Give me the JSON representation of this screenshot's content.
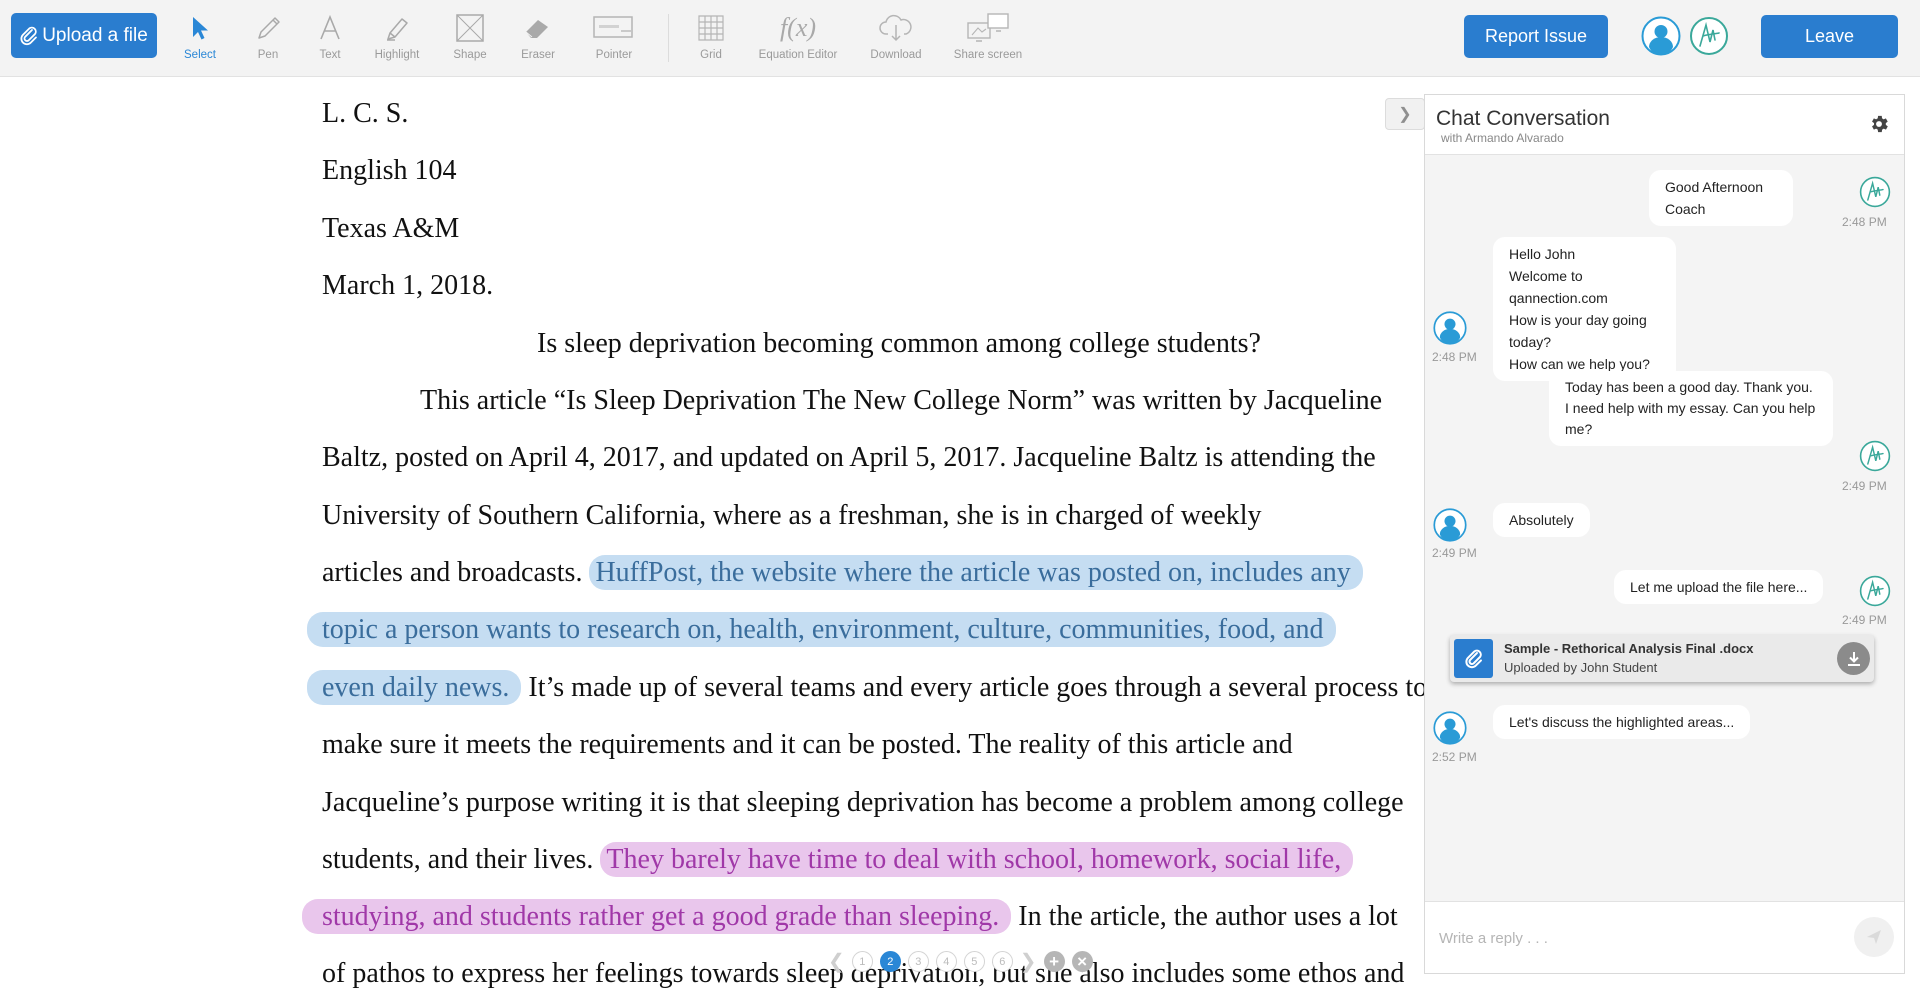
{
  "toolbar": {
    "upload_label": "Upload a file",
    "tools": [
      {
        "label": "Select",
        "icon": "cursor-icon",
        "active": true
      },
      {
        "label": "Pen",
        "icon": "pen-icon"
      },
      {
        "label": "Text",
        "icon": "text-icon"
      },
      {
        "label": "Highlight",
        "icon": "highlighter-icon"
      },
      {
        "label": "Shape",
        "icon": "shape-icon"
      },
      {
        "label": "Eraser",
        "icon": "eraser-icon"
      },
      {
        "label": "Pointer",
        "icon": "pointer-icon"
      },
      {
        "label": "Grid",
        "icon": "grid-icon"
      },
      {
        "label": "Equation Editor",
        "icon": "function-icon"
      },
      {
        "label": "Download",
        "icon": "cloud-download-icon"
      },
      {
        "label": "Share screen",
        "icon": "screens-icon"
      }
    ],
    "report_label": "Report Issue",
    "leave_label": "Leave"
  },
  "document": {
    "header_lines": [
      "L. C. S.",
      "English 104",
      "Texas A&M",
      "March 1, 2018."
    ],
    "title": "Is sleep deprivation becoming common among college students?",
    "para1": "This article “Is Sleep Deprivation The New College Norm” was written by Jacqueline",
    "line2": "Baltz, posted on April 4, 2017, and updated on April 5, 2017. Jacqueline Baltz is attending the",
    "line3": "University of Southern California, where as a freshman, she is in charged of weekly",
    "line4_plain": "articles and broadcasts.",
    "line4_hl": "HuffPost, the website where the article was posted on, includes any",
    "line5_hl": "topic a person wants to research on, health, environment, culture, communities, food, and",
    "line6_hl": "even daily news.",
    "line6_plain": "It’s made up of several teams and every article goes through a several process to",
    "line7": "make sure it meets the requirements and it can be posted. The reality of this article and",
    "line8": "Jacqueline’s purpose writing it is that sleeping deprivation has become a problem among college",
    "line9_plain": "students, and their lives.",
    "line9_hl": "They barely have time to deal with school, homework, social life,",
    "line10_hl": "studying, and students rather get a good grade than sleeping.",
    "line10_plain": "In the article, the author uses a lot",
    "line11": "of pathos to express her feelings towards sleep deprivation, but she also includes some ethos and"
  },
  "pagination": {
    "pages": [
      "1",
      "2",
      "3",
      "4",
      "5",
      "6"
    ],
    "current": "2"
  },
  "chat": {
    "title": "Chat Conversation",
    "subtitle": "with Armando Alvarado",
    "messages": [
      {
        "from": "coach",
        "lines": [
          "Good Afternoon Coach"
        ],
        "time": "2:48 PM"
      },
      {
        "from": "self",
        "lines": [
          "Hello John",
          "Welcome to qannection.com",
          "How is your day going today?",
          "How can we help you?"
        ],
        "time": "2:48 PM"
      },
      {
        "from": "coach",
        "lines": [
          "Today has been a good day. Thank you.",
          "I need help with my essay. Can you help me?"
        ],
        "time": "2:49 PM"
      },
      {
        "from": "self",
        "lines": [
          "Absolutely"
        ],
        "time": "2:49 PM"
      },
      {
        "from": "coach",
        "lines": [
          "Let me upload the file here..."
        ],
        "time": "2:49 PM"
      },
      {
        "from": "self",
        "lines": [
          "Let's discuss the highlighted areas..."
        ],
        "time": "2:52 PM"
      }
    ],
    "file": {
      "name": "Sample - Rethorical Analysis Final .docx",
      "uploaded_by": "Uploaded by John Student"
    },
    "reply_placeholder": "Write a reply . . ."
  },
  "colors": {
    "primary": "#2a7dcf",
    "highlight_blue": "#c5ddf2",
    "highlight_pink": "#e9c6ec"
  }
}
